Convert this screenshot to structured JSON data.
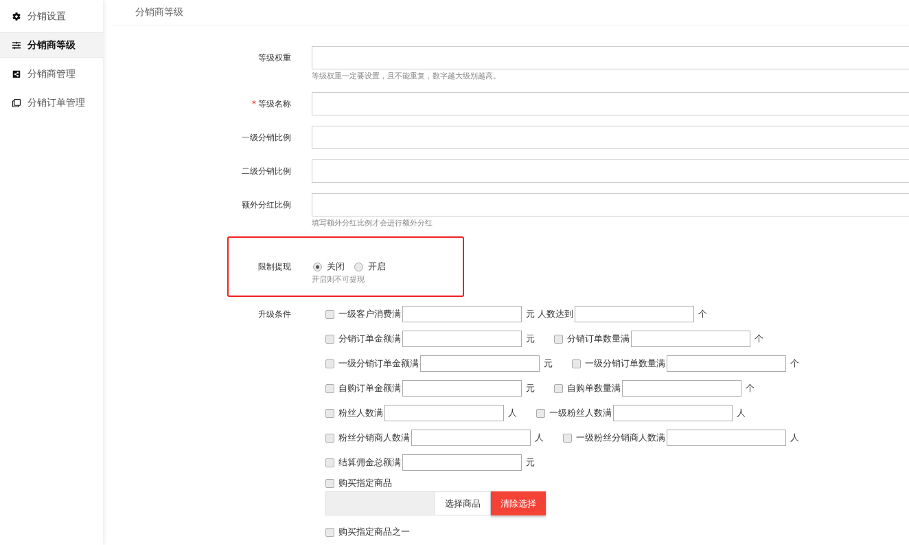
{
  "sidebar": {
    "items": [
      {
        "label": "分销设置",
        "selected": false
      },
      {
        "label": "分销商等级",
        "selected": true
      },
      {
        "label": "分销商管理",
        "selected": false
      },
      {
        "label": "分销订单管理",
        "selected": false
      }
    ]
  },
  "page_title": "分销商等级",
  "fields": [
    {
      "label": "等级权重",
      "hint": "等级权重一定要设置，且不能重复，数字越大级别越高。"
    },
    {
      "required_mark": "*",
      "label": "等级名称"
    },
    {
      "label": "一级分销比例"
    },
    {
      "label": "二级分销比例"
    },
    {
      "label": "额外分红比例",
      "hint": "填写额外分红比例才会进行额外分红"
    }
  ],
  "restrict_withdraw": {
    "label": "限制提现",
    "highlighted": true,
    "options": [
      {
        "label": "关闭",
        "selected": true
      },
      {
        "label": "开启",
        "selected": false
      }
    ],
    "hint": "开启则不可提现"
  },
  "upgrade": {
    "label": "升级条件",
    "rows": [
      [
        {
          "kind": "check",
          "label": "一级客户消费满",
          "checked": false,
          "unit": "元"
        },
        {
          "kind": "plain",
          "label": "人数达到",
          "unit": "个"
        }
      ],
      [
        {
          "kind": "check",
          "label": "分销订单金额满",
          "checked": false,
          "unit": "元"
        },
        {
          "kind": "check",
          "label": "分销订单数量满",
          "checked": false,
          "unit": "个"
        }
      ],
      [
        {
          "kind": "check",
          "label": "一级分销订单金额满",
          "checked": false,
          "unit": "元"
        },
        {
          "kind": "check",
          "label": "一级分销订单数量满",
          "checked": false,
          "unit": "个"
        }
      ],
      [
        {
          "kind": "check",
          "label": "自购订单金额满",
          "checked": false,
          "unit": "元"
        },
        {
          "kind": "check",
          "label": "自购单数量满",
          "checked": false,
          "unit": "个"
        }
      ],
      [
        {
          "kind": "check",
          "label": "粉丝人数满",
          "checked": false,
          "unit": "人"
        },
        {
          "kind": "check",
          "label": "一级粉丝人数满",
          "checked": false,
          "unit": "人"
        }
      ],
      [
        {
          "kind": "check",
          "label": "粉丝分销商人数满",
          "checked": false,
          "unit": "人"
        },
        {
          "kind": "check",
          "label": "一级粉丝分销商人数满",
          "checked": false,
          "unit": "人"
        }
      ],
      [
        {
          "kind": "check",
          "label": "结算佣金总额满",
          "checked": false,
          "unit": "元"
        }
      ]
    ],
    "goods": {
      "label": "购买指定商品",
      "checked": false,
      "select_button": "选择商品",
      "clear_button": "清除选择"
    },
    "goods_any": {
      "label": "购买指定商品之一",
      "checked": false
    }
  }
}
